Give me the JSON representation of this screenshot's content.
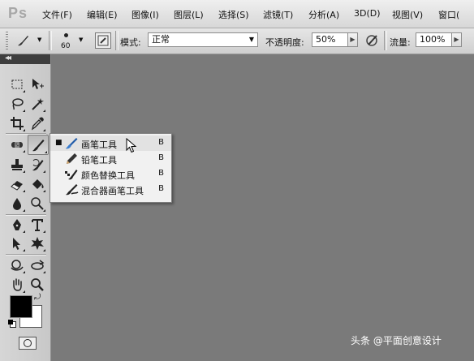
{
  "app": {
    "logo": "Ps"
  },
  "menubar": {
    "items": [
      "文件(F)",
      "编辑(E)",
      "图像(I)",
      "图层(L)",
      "选择(S)",
      "滤镜(T)",
      "分析(A)",
      "3D(D)",
      "视图(V)",
      "窗口("
    ]
  },
  "options": {
    "brush_size": "60",
    "mode_label": "模式:",
    "mode_value": "正常",
    "opacity_label": "不透明度:",
    "opacity_value": "50%",
    "flow_label": "流量:",
    "flow_value": "100%"
  },
  "toolbar": {
    "collapse_icon": "double-chevron-left-icon"
  },
  "flyout": {
    "items": [
      {
        "label": "画笔工具",
        "key": "B",
        "current": true,
        "icon": "brush-icon"
      },
      {
        "label": "铅笔工具",
        "key": "B",
        "current": false,
        "icon": "pencil-icon"
      },
      {
        "label": "颜色替换工具",
        "key": "B",
        "current": false,
        "icon": "color-replacement-icon"
      },
      {
        "label": "混合器画笔工具",
        "key": "B",
        "current": false,
        "icon": "mixer-brush-icon"
      }
    ],
    "bullet": "■"
  },
  "colors": {
    "foreground": "#000000",
    "background": "#ffffff",
    "canvas": "#7a7a7a"
  },
  "watermark": "头条 @平面创意设计"
}
